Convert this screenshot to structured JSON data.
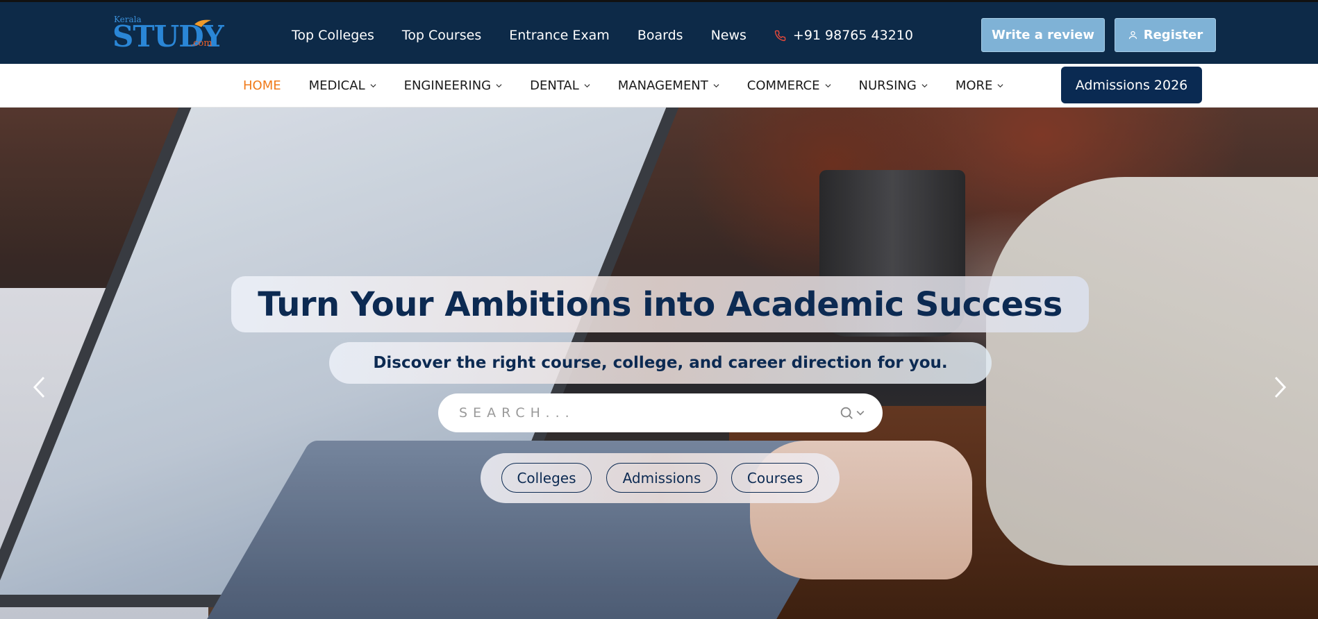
{
  "logo": {
    "top_text": "Kerala",
    "main_text": "STUDY",
    "suffix": ".com"
  },
  "topnav": {
    "links": [
      "Top Colleges",
      "Top Courses",
      "Entrance Exam",
      "Boards",
      "News"
    ],
    "phone": "+91 98765 43210",
    "write_review": "Write a review",
    "register": "Register"
  },
  "mainnav": {
    "items": [
      {
        "label": "HOME",
        "active": true,
        "dropdown": false
      },
      {
        "label": "MEDICAL",
        "active": false,
        "dropdown": true
      },
      {
        "label": "ENGINEERING",
        "active": false,
        "dropdown": true
      },
      {
        "label": "DENTAL",
        "active": false,
        "dropdown": true
      },
      {
        "label": "MANAGEMENT",
        "active": false,
        "dropdown": true
      },
      {
        "label": "COMMERCE",
        "active": false,
        "dropdown": true
      },
      {
        "label": "NURSING",
        "active": false,
        "dropdown": true
      },
      {
        "label": "MORE",
        "active": false,
        "dropdown": true
      }
    ],
    "admissions_button": "Admissions 2026"
  },
  "hero": {
    "headline": "Turn Your Ambitions into Academic Success",
    "subtitle": "Discover the right course, college, and career direction for you.",
    "search_placeholder": "SEARCH...",
    "pills": [
      "Colleges",
      "Admissions",
      "Courses"
    ]
  },
  "icons": {
    "phone": "phone-icon",
    "user": "user-icon",
    "search": "search-icon",
    "chevron": "chevron-down-icon",
    "prev": "chevron-left-icon",
    "next": "chevron-right-icon"
  },
  "colors": {
    "topbar_bg": "#0d2a48",
    "accent_orange": "#f07a1a",
    "button_light_blue": "#7fb2d6",
    "navy": "#0a2a52"
  }
}
